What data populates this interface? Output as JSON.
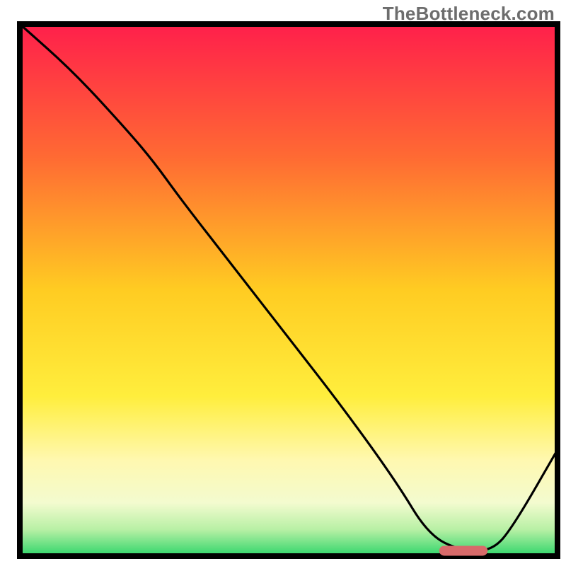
{
  "watermark": "TheBottleneck.com",
  "chart_data": {
    "type": "line",
    "title": "",
    "xlabel": "",
    "ylabel": "",
    "xlim": [
      0,
      100
    ],
    "ylim": [
      0,
      100
    ],
    "series": [
      {
        "name": "bottleneck-curve",
        "x": [
          0,
          10,
          20,
          25,
          30,
          40,
          50,
          60,
          70,
          76,
          82,
          88,
          92,
          100
        ],
        "y": [
          100,
          91,
          80,
          74,
          67,
          54,
          41,
          28,
          14,
          4,
          1,
          1,
          6,
          20
        ]
      }
    ],
    "marker": {
      "name": "optimal-range",
      "x_start": 78,
      "x_end": 87,
      "y": 1
    },
    "background": {
      "type": "vertical-gradient",
      "stops": [
        {
          "pos": 0.0,
          "color": "#ff1f4b"
        },
        {
          "pos": 0.25,
          "color": "#ff6a33"
        },
        {
          "pos": 0.5,
          "color": "#ffcc22"
        },
        {
          "pos": 0.7,
          "color": "#ffee3d"
        },
        {
          "pos": 0.82,
          "color": "#fff8b0"
        },
        {
          "pos": 0.9,
          "color": "#f3fbcf"
        },
        {
          "pos": 0.95,
          "color": "#b8f0a5"
        },
        {
          "pos": 1.0,
          "color": "#2fd56a"
        }
      ]
    },
    "frame_color": "#000000",
    "curve_color": "#000000",
    "marker_color": "#d86a6a"
  }
}
